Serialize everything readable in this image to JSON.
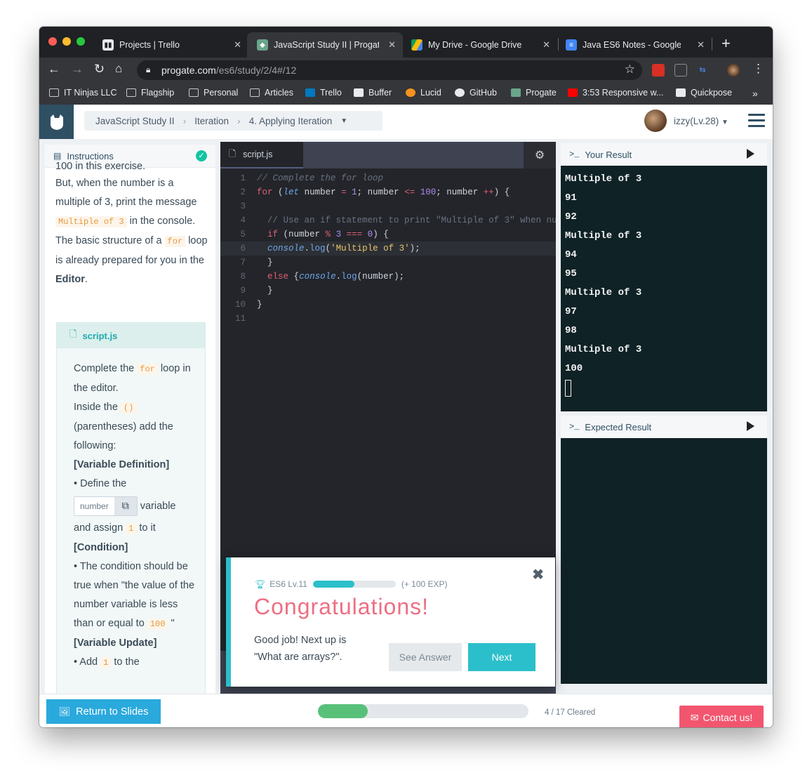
{
  "browser": {
    "tabs": [
      {
        "title": "Projects | Trello"
      },
      {
        "title": "JavaScript Study II | Progate"
      },
      {
        "title": "My Drive - Google Drive"
      },
      {
        "title": "Java ES6 Notes - Google Docs"
      }
    ],
    "url_host": "progate.com",
    "url_path": "/es6/study/2/4#/12",
    "bookmarks": [
      "IT Ninjas LLC",
      "Flagship",
      "Personal",
      "Articles",
      "Trello",
      "Buffer",
      "Lucid",
      "GitHub",
      "Progate",
      "3:53 Responsive w...",
      "Quickpose"
    ],
    "bookmark_more": "»"
  },
  "header": {
    "breadcrumbs": [
      "JavaScript Study II",
      "Iteration",
      "4. Applying Iteration"
    ],
    "username": "izzy(Lv.28)"
  },
  "instructions": {
    "title": "Instructions",
    "p_partial": "100 in this exercise.",
    "p1_text": "But, when the number is a multiple of 3, print the message",
    "p1_code": "Multiple of 3",
    "p1_end": "in the console.",
    "p2_text": "The basic structure of a",
    "p2_code": "for",
    "p2_end": "loop is already prepared for you in the",
    "p2_bold": "Editor",
    "p2_dot": ".",
    "task_file": "script.js",
    "t1": "Complete the",
    "t1_code": "for",
    "t1_end": "loop in the editor.",
    "t2": "Inside the",
    "t2_code": "()",
    "t2_end": "(parentheses) add the following:",
    "h_var": "[Variable Definition]",
    "t3": "• Define the",
    "t3_box": "number",
    "t3_end": "variable",
    "t4": "and assign",
    "t4_code": "1",
    "t4_end": "to it",
    "h_cond": "[Condition]",
    "t5": "• The condition should be true when \"the value of the number variable is less than or equal to",
    "t5_code": "100",
    "t5_end": "\"",
    "h_upd": "[Variable Update]",
    "t6": "• Add",
    "t6_code": "1",
    "t6_end": "to the"
  },
  "editor": {
    "file_tab": "script.js",
    "lines": [
      {
        "n": "1",
        "html": "<span style=\"color:#6a7180;font-style:italic\">// Complete the for loop</span>"
      },
      {
        "n": "2",
        "html": "<span style=\"color:#e15f76\">for</span> <span style=\"color:#cfd3dc\">(</span><span style=\"color:#6fa6e8;font-style:italic\">let</span> <span style=\"color:#cfd3dc\">number</span> <span style=\"color:#e15f76\">=</span> <span style=\"color:#b08cf0\">1</span><span style=\"color:#cfd3dc\">; number</span> <span style=\"color:#e15f76\">&lt;=</span> <span style=\"color:#b08cf0\">100</span><span style=\"color:#cfd3dc\">; number</span> <span style=\"color:#e15f76\">++</span><span style=\"color:#cfd3dc\">) {</span>"
      },
      {
        "n": "3",
        "html": ""
      },
      {
        "n": "4",
        "html": "  <span style=\"color:#6a7180\">// Use an if statement to print \"Multiple of 3\" when nu</span>"
      },
      {
        "n": "5",
        "html": "  <span style=\"color:#e15f76\">if</span> <span style=\"color:#cfd3dc\">(number</span> <span style=\"color:#e15f76\">%</span> <span style=\"color:#b08cf0\">3</span> <span style=\"color:#e15f76\">===</span> <span style=\"color:#b08cf0\">0</span><span style=\"color:#cfd3dc\">) {</span>"
      },
      {
        "n": "6",
        "html": "  <span style=\"color:#6fa6e8;font-style:italic\">console</span><span style=\"color:#cfd3dc\">.</span><span style=\"color:#6fa6e8\">log</span><span style=\"color:#cfd3dc\">(</span><span style=\"color:#e6c46a\">'Multiple of 3'</span><span style=\"color:#cfd3dc\">);</span>"
      },
      {
        "n": "7",
        "html": "  <span style=\"color:#cfd3dc\">}</span>"
      },
      {
        "n": "8",
        "html": "  <span style=\"color:#e15f76\">else</span> <span style=\"color:#cfd3dc\">{</span><span style=\"color:#6fa6e8;font-style:italic\">console</span><span style=\"color:#cfd3dc\">.</span><span style=\"color:#6fa6e8\">log</span><span style=\"color:#cfd3dc\">(number);</span>"
      },
      {
        "n": "9",
        "html": "  <span style=\"color:#cfd3dc\">}</span>"
      },
      {
        "n": "10",
        "html": "<span style=\"color:#cfd3dc\">}</span>"
      },
      {
        "n": "11",
        "html": ""
      }
    ]
  },
  "your_result": {
    "title": "Your Result",
    "lines": [
      "Multiple of 3",
      "91",
      "92",
      "Multiple of 3",
      "94",
      "95",
      "Multiple of 3",
      "97",
      "98",
      "Multiple of 3",
      "100"
    ]
  },
  "expected_result": {
    "title": "Expected Result"
  },
  "modal": {
    "level_label": "ES6 Lv.11",
    "exp_label": "(+ 100 EXP)",
    "level_progress": 0.5,
    "title": "Congratulations!",
    "message": "Good job! Next up is \"What are arrays?\".",
    "see_answer": "See Answer",
    "next": "Next",
    "close": "✖"
  },
  "footer": {
    "return_label": "Return to Slides",
    "progress_fraction": 0.235,
    "cleared": "4 / 17 Cleared",
    "contact": "Contact us!"
  },
  "colors": {
    "accent_teal": "#2bbfcb",
    "console_bg": "#0f2226",
    "brand_pink": "#ee6f83",
    "contact_red": "#f2566f",
    "slides_blue": "#2aa9dd",
    "progress_green": "#59c07a"
  }
}
